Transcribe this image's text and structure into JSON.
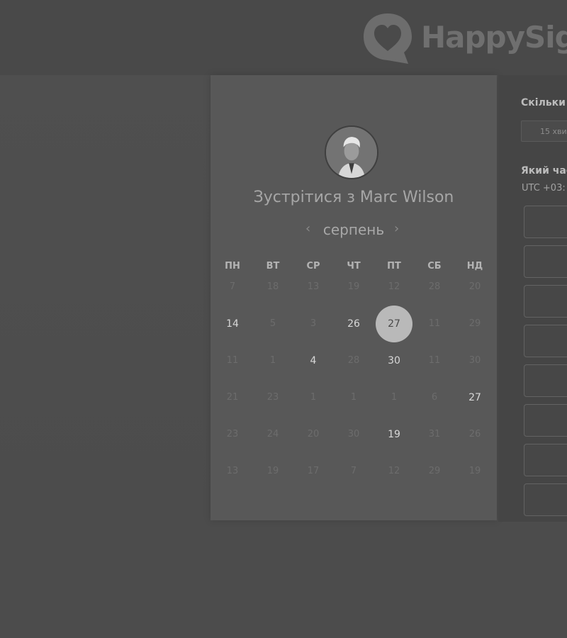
{
  "brand": {
    "name": "HappySig"
  },
  "calendar": {
    "meet_title": "Зустрітися з Marc Wilson",
    "month": "серпень",
    "prev_icon": "chevron-left-icon",
    "next_icon": "chevron-right-icon",
    "prev_glyph": "‹",
    "next_glyph": "›",
    "weekdays": [
      "ПН",
      "ВТ",
      "СР",
      "ЧТ",
      "ПТ",
      "СБ",
      "НД"
    ],
    "weeks": [
      [
        {
          "d": "7",
          "active": false
        },
        {
          "d": "18",
          "active": false
        },
        {
          "d": "13",
          "active": false
        },
        {
          "d": "19",
          "active": false
        },
        {
          "d": "12",
          "active": false
        },
        {
          "d": "28",
          "active": false
        },
        {
          "d": "20",
          "active": false
        }
      ],
      [
        {
          "d": "14",
          "active": true
        },
        {
          "d": "5",
          "active": false
        },
        {
          "d": "3",
          "active": false
        },
        {
          "d": "26",
          "active": true
        },
        {
          "d": "27",
          "active": true,
          "selected": true
        },
        {
          "d": "11",
          "active": false
        },
        {
          "d": "29",
          "active": false
        }
      ],
      [
        {
          "d": "11",
          "active": false
        },
        {
          "d": "1",
          "active": false
        },
        {
          "d": "4",
          "active": true
        },
        {
          "d": "28",
          "active": false
        },
        {
          "d": "30",
          "active": true
        },
        {
          "d": "11",
          "active": false
        },
        {
          "d": "30",
          "active": false
        }
      ],
      [
        {
          "d": "21",
          "active": false
        },
        {
          "d": "23",
          "active": false
        },
        {
          "d": "1",
          "active": false
        },
        {
          "d": "1",
          "active": false
        },
        {
          "d": "1",
          "active": false
        },
        {
          "d": "6",
          "active": false
        },
        {
          "d": "27",
          "active": true
        }
      ],
      [
        {
          "d": "23",
          "active": false
        },
        {
          "d": "24",
          "active": false
        },
        {
          "d": "20",
          "active": false
        },
        {
          "d": "30",
          "active": false
        },
        {
          "d": "19",
          "active": true
        },
        {
          "d": "31",
          "active": false
        },
        {
          "d": "26",
          "active": false
        }
      ],
      [
        {
          "d": "13",
          "active": false
        },
        {
          "d": "19",
          "active": false
        },
        {
          "d": "17",
          "active": false
        },
        {
          "d": "7",
          "active": false
        },
        {
          "d": "12",
          "active": false
        },
        {
          "d": "29",
          "active": false
        },
        {
          "d": "19",
          "active": false
        }
      ]
    ]
  },
  "side_panel": {
    "duration_label": "Скільки",
    "duration_value": "15 хви",
    "time_label": "Який час",
    "timezone": "UTC +03:",
    "slot_count": 8
  },
  "colors": {
    "overlay": "#4c4c4c",
    "card": "#585858",
    "selected_day": "#b9b9b9"
  }
}
